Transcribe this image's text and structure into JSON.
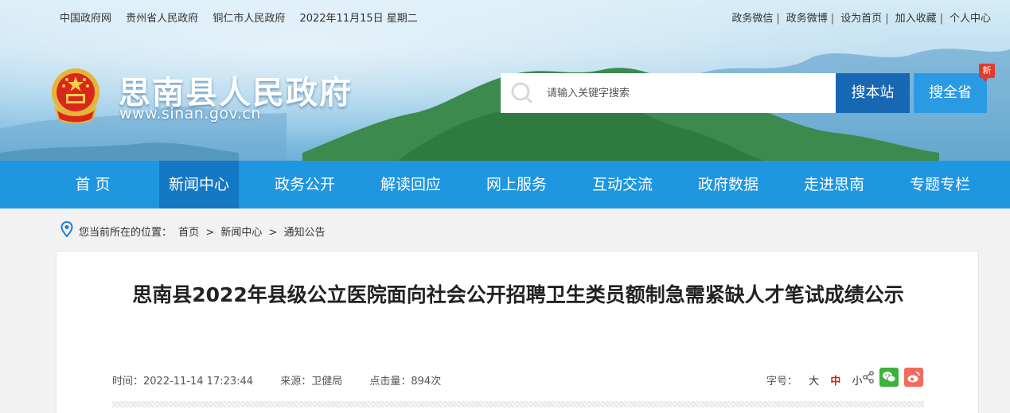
{
  "topbar": {
    "links_left": [
      "中国政府网",
      "贵州省人民政府",
      "铜仁市人民政府"
    ],
    "date": "2022年11月15日 星期二",
    "links_right": [
      "政务微信",
      "政务微博",
      "设为首页",
      "加入收藏",
      "个人中心"
    ]
  },
  "header": {
    "title": "思南县人民政府",
    "url": "www.sinan.gov.cn"
  },
  "search": {
    "placeholder": "请输入关键字搜索",
    "btn_site": "搜本站",
    "btn_province": "搜全省",
    "badge": "新"
  },
  "nav": {
    "items": [
      "首 页",
      "新闻中心",
      "政务公开",
      "解读回应",
      "网上服务",
      "互动交流",
      "政府数据",
      "走进思南",
      "专题专栏"
    ],
    "active": "新闻中心"
  },
  "breadcrumb": {
    "prefix": "您当前所在的位置：",
    "items": [
      "首页",
      "新闻中心",
      "通知公告"
    ],
    "separator": ">"
  },
  "article": {
    "title": "思南县2022年县级公立医院面向社会公开招聘卫生类员额制急需紧缺人才笔试成绩公示",
    "time": "时间：2022-11-14 17:23:44",
    "source": "来源：卫健局",
    "hits": "点击量：894次",
    "fontsize_label": "字号：",
    "fontsize_options": [
      "大",
      "中",
      "小"
    ]
  },
  "colors": {
    "nav_bg": "#1e96e0",
    "nav_active": "#1478c4",
    "btn_site": "#1767b3",
    "btn_province": "#2a9be3",
    "accent_red": "#d81e06"
  },
  "icons": {
    "search": "search-icon",
    "location": "location-pin-icon",
    "share": "share-icon",
    "wechat": "wechat-icon",
    "weibo": "weibo-icon",
    "emblem": "national-emblem-icon"
  }
}
